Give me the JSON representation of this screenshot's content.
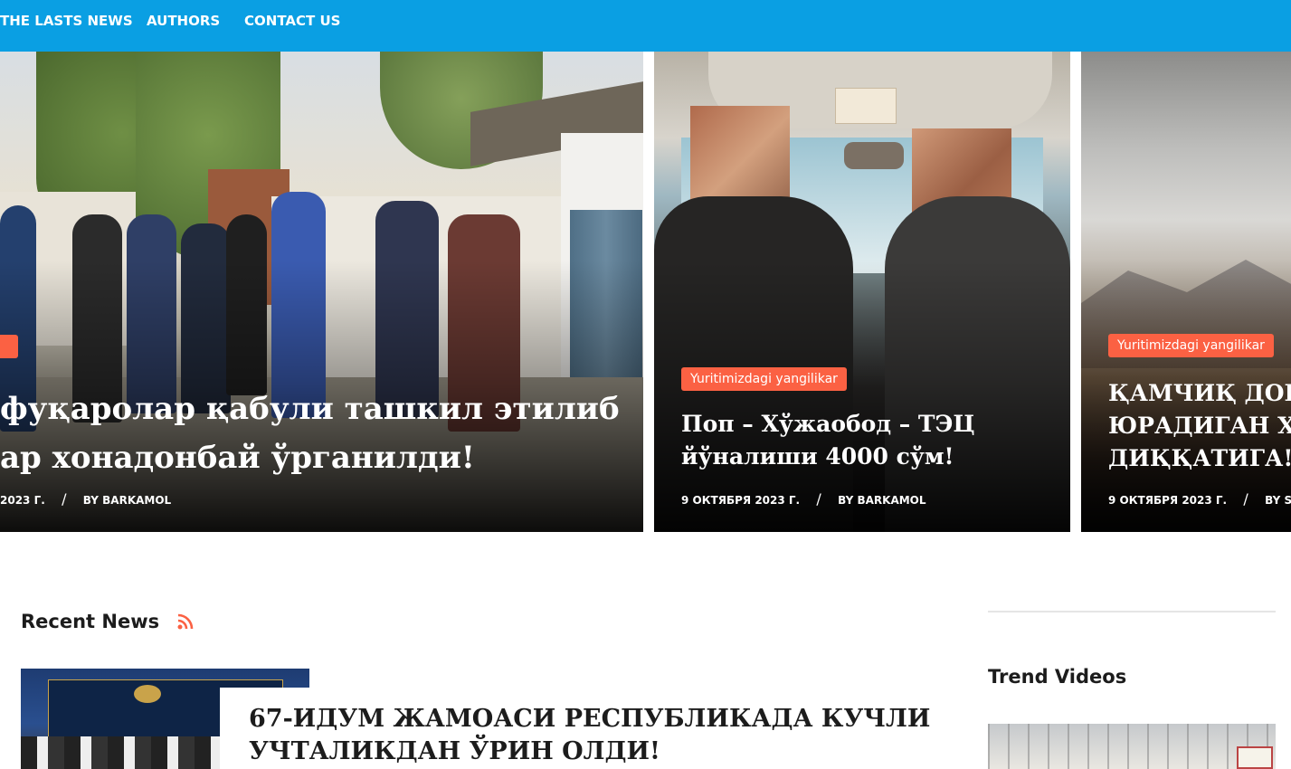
{
  "nav": {
    "items": [
      "THE LASTS NEWS",
      "AUTHORS",
      "CONTACT US"
    ]
  },
  "slider": [
    {
      "title_line1": "фуқаролар қабули ташкил этилиб",
      "title_line2": "ар хонадонбай ўрганилди!",
      "date": "2023 Г.",
      "author": "BY BARKAMOL"
    },
    {
      "category": "Yuritimizdagi yangilikar",
      "title_line1": "Поп – Хўжаобод – ТЭЦ",
      "title_line2": "йўналиши 4000 сўм!",
      "date": "9 ОКТЯБРЯ 2023 Г.",
      "author": "BY BARKAMOL"
    },
    {
      "category": "Yuritimizdagi yangilikar",
      "title_line1": "ҚАМЧИҚ ДОВО",
      "title_line2": "ЮРАДИГАН ҲА",
      "title_line3": "ДИҚҚАТИГА!",
      "date": "9 ОКТЯБРЯ 2023 Г.",
      "author": "BY SH"
    }
  ],
  "recent": {
    "heading": "Recent News",
    "icon": "rss-icon",
    "article": {
      "title_line1": "67-ИДУМ ЖАМОАСИ РЕСПУБЛИКАДА КУЧЛИ",
      "title_line2": "УЧТАЛИКДАН ЎРИН ОЛДИ!"
    }
  },
  "sidebar": {
    "trend_heading": "Trend Videos"
  },
  "colors": {
    "nav_bg": "#0a9fe3",
    "accent": "#fb6143",
    "text_dark": "#1c1c1c"
  }
}
